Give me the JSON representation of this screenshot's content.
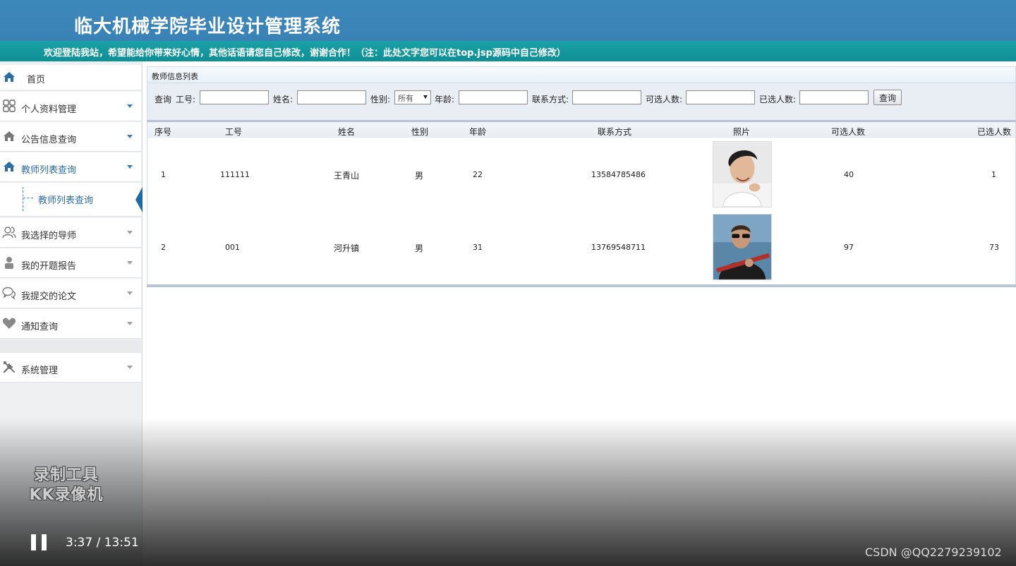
{
  "header": {
    "title": "临大机械学院毕业设计管理系统",
    "marquee": "欢迎登陆我站，希望能给你带来好心情，其他话语请您自己修改，谢谢合作！（注：此处文字您可以在top.jsp源码中自己修改）"
  },
  "sidebar": {
    "home": "首页",
    "items": [
      {
        "label": "个人资料管理",
        "icon": "grid-icon"
      },
      {
        "label": "公告信息查询",
        "icon": "house-icon"
      },
      {
        "label": "教师列表查询",
        "icon": "house-icon"
      },
      {
        "label": "我选择的导师",
        "icon": "users-icon"
      },
      {
        "label": "我的开题报告",
        "icon": "user-icon"
      },
      {
        "label": "我提交的论文",
        "icon": "chat-icon"
      },
      {
        "label": "通知查询",
        "icon": "heart-icon"
      },
      {
        "label": "系统管理",
        "icon": "tools-icon"
      }
    ],
    "sub_item": "教师列表查询"
  },
  "panel": {
    "title": "教师信息列表"
  },
  "search": {
    "prefix": "查询",
    "labels": [
      "工号:",
      "姓名:",
      "性别:",
      "年龄:",
      "联系方式:",
      "可选人数:",
      "已选人数:"
    ],
    "gender_selected": "所有",
    "button": "查询"
  },
  "table": {
    "headers": [
      "序号",
      "工号",
      "姓名",
      "性别",
      "年龄",
      "联系方式",
      "照片",
      "可选人数",
      "已选人数"
    ],
    "rows": [
      {
        "index": "1",
        "id": "111111",
        "name": "王青山",
        "gender": "男",
        "age": "22",
        "phone": "13584785486",
        "selectable": "40",
        "selected": "1"
      },
      {
        "index": "2",
        "id": "001",
        "name": "河升镇",
        "gender": "男",
        "age": "31",
        "phone": "13769548711",
        "selectable": "97",
        "selected": "73"
      }
    ]
  },
  "overlay": {
    "watermark_line1": "录制工具",
    "watermark_line2": "KK录像机",
    "time": "3:37 / 13:51",
    "credit": "CSDN @QQ2279239102"
  },
  "colors": {
    "header_blue": "#3a82b6",
    "marquee_teal": "#0f8f96",
    "accent_blue": "#2d6da6"
  }
}
